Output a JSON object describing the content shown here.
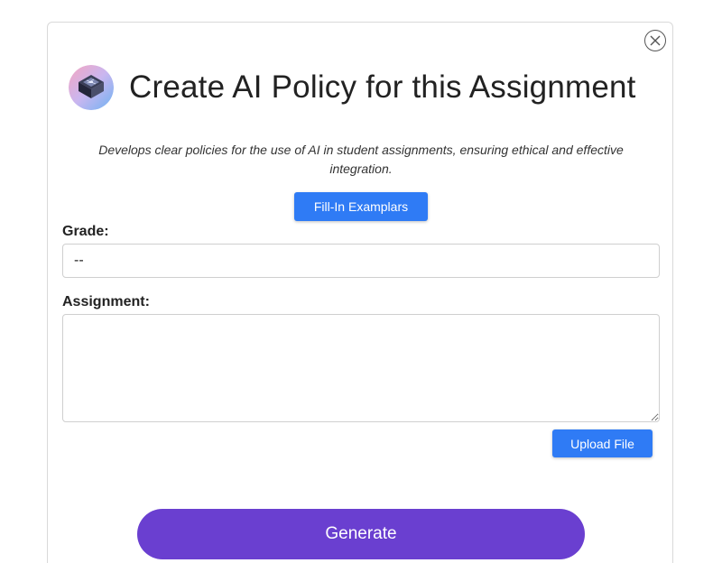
{
  "modal": {
    "title": "Create AI Policy for this Assignment",
    "description": "Develops clear policies for the use of AI in student assignments, ensuring ethical and effective integration.",
    "fill_in_label": "Fill-In Examplars",
    "icons": {
      "close": "close-circle-icon",
      "avatar": "ai-chip-icon"
    }
  },
  "form": {
    "grade": {
      "label": "Grade:",
      "value": "--"
    },
    "assignment": {
      "label": "Assignment:",
      "value": ""
    },
    "upload_label": "Upload File",
    "generate_label": "Generate"
  },
  "colors": {
    "primary_blue": "#2f7bf5",
    "generate_purple": "#6a3fd0",
    "border": "#cfcfcf"
  }
}
